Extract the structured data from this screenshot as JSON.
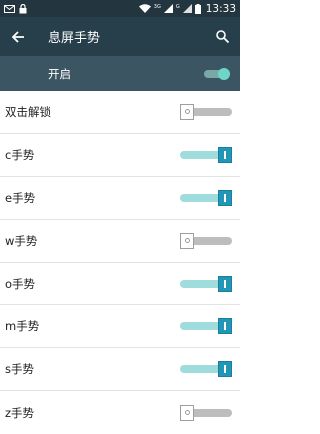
{
  "status_bar": {
    "time": "13:33",
    "signal_label_1": "3G",
    "signal_label_2": "G",
    "icons": [
      "mail-icon",
      "lock-icon",
      "wifi-icon",
      "signal-icon",
      "signal-icon-2",
      "battery-icon"
    ]
  },
  "app_bar": {
    "title": "息屏手势",
    "back_icon": "arrow-left-icon",
    "search_icon": "search-icon"
  },
  "master": {
    "label": "开启",
    "enabled": true
  },
  "gestures": [
    {
      "label": "双击解锁",
      "on": false
    },
    {
      "label": "c手势",
      "on": true
    },
    {
      "label": "e手势",
      "on": true
    },
    {
      "label": "w手势",
      "on": false
    },
    {
      "label": "o手势",
      "on": true
    },
    {
      "label": "m手势",
      "on": true
    },
    {
      "label": "s手势",
      "on": true
    },
    {
      "label": "z手势",
      "on": false
    }
  ],
  "colors": {
    "status_bar": "#23363f",
    "app_bar": "#263f4b",
    "master_row": "#3b5662",
    "switch_on_thumb": "#2196b6",
    "switch_on_track": "#9fdcdc",
    "switch_off_track": "#bdbdbd"
  }
}
